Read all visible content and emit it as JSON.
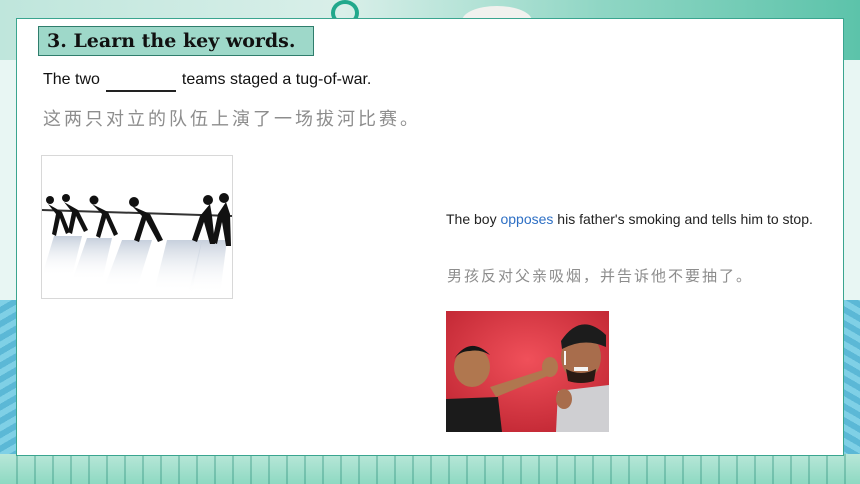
{
  "slide": {
    "section_title": "3.  Learn the key words.",
    "sentence1": {
      "before": "The two",
      "after": "teams staged a tug-of-war."
    },
    "translation1": "这两只对立的队伍上演了一场拔河比赛。",
    "sentence2": {
      "before": "The boy ",
      "keyword": "opposes",
      "after": " his father's smoking and tells him to stop."
    },
    "translation2": "男孩反对父亲吸烟，并告诉他不要抽了。"
  },
  "images": {
    "tug": "tug-of-war-silhouette",
    "boy": "boy-stopping-father-smoking"
  },
  "colors": {
    "title_bg": "#9ed8c9",
    "keyword": "#2d6fc4",
    "translation": "#8d8d8d"
  }
}
